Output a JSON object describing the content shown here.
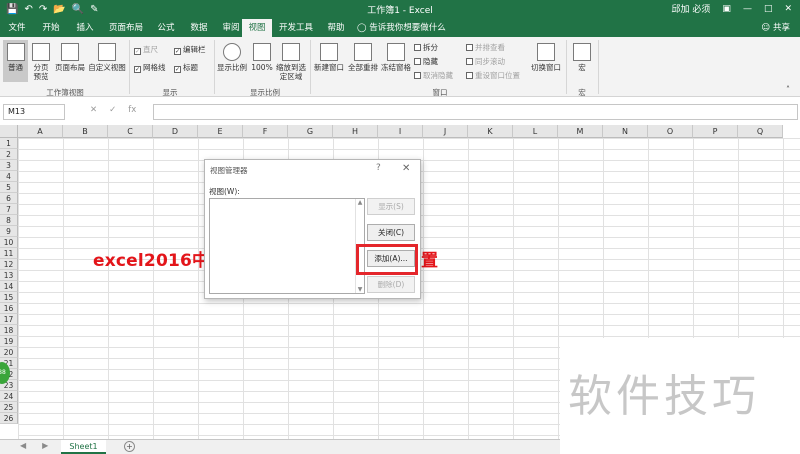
{
  "window": {
    "title": "工作簿1 - Excel",
    "user": "邱加 必须",
    "share_label": "共享",
    "tell_me": "告诉我你想要做什么"
  },
  "tabs": [
    {
      "label": "文件",
      "active": false
    },
    {
      "label": "开始",
      "active": false
    },
    {
      "label": "插入",
      "active": false
    },
    {
      "label": "页面布局",
      "active": false
    },
    {
      "label": "公式",
      "active": false
    },
    {
      "label": "数据",
      "active": false
    },
    {
      "label": "审阅",
      "active": false
    },
    {
      "label": "视图",
      "active": true
    },
    {
      "label": "开发工具",
      "active": false
    },
    {
      "label": "帮助",
      "active": false
    }
  ],
  "ribbon": {
    "workbook_views": {
      "group_label": "工作簿视图",
      "normal": "普通",
      "page_break": "分页预览",
      "page_layout": "页面布局",
      "custom_views": "自定义视图"
    },
    "show": {
      "group_label": "显示",
      "ruler": "直尺",
      "formula_bar": "编辑栏",
      "gridlines": "网格线",
      "headings": "标题"
    },
    "zoom": {
      "group_label": "显示比例",
      "zoom": "显示比例",
      "zoom100": "100%",
      "zoom_selection": "缩放到选定区域"
    },
    "window": {
      "group_label": "窗口",
      "new_window": "新建窗口",
      "arrange_all": "全部重排",
      "freeze_panes": "冻结窗格",
      "split": "拆分",
      "hide": "隐藏",
      "unhide": "取消隐藏",
      "view_side": "并排查看",
      "sync_scroll": "同步滚动",
      "reset_pos": "重设窗口位置",
      "switch_windows": "切换窗口"
    },
    "macros": {
      "group_label": "宏",
      "macros": "宏"
    }
  },
  "formula_bar": {
    "name_box": "M13",
    "fx": "fx",
    "formula": ""
  },
  "columns": [
    "A",
    "B",
    "C",
    "D",
    "E",
    "F",
    "G",
    "H",
    "I",
    "J",
    "K",
    "L",
    "M",
    "N",
    "O",
    "P",
    "Q"
  ],
  "rows": [
    "1",
    "2",
    "3",
    "4",
    "5",
    "6",
    "7",
    "8",
    "9",
    "10",
    "11",
    "12",
    "13",
    "14",
    "15",
    "16",
    "17",
    "18",
    "19",
    "20",
    "21",
    "22",
    "23",
    "24",
    "25",
    "26"
  ],
  "cell_text": {
    "left": "excel2016中",
    "right": "置"
  },
  "dialog": {
    "title": "视图管理器",
    "help": "?",
    "close": "✕",
    "list_label": "视图(W):",
    "buttons": {
      "show": "显示(S)",
      "close": "关闭(C)",
      "add": "添加(A)...",
      "delete": "删除(D)"
    }
  },
  "sheets": {
    "active": "Sheet1",
    "add": "+"
  },
  "watermark": "软件技巧",
  "colors": {
    "excel_green": "#217346",
    "highlight_red": "#e4262b"
  }
}
